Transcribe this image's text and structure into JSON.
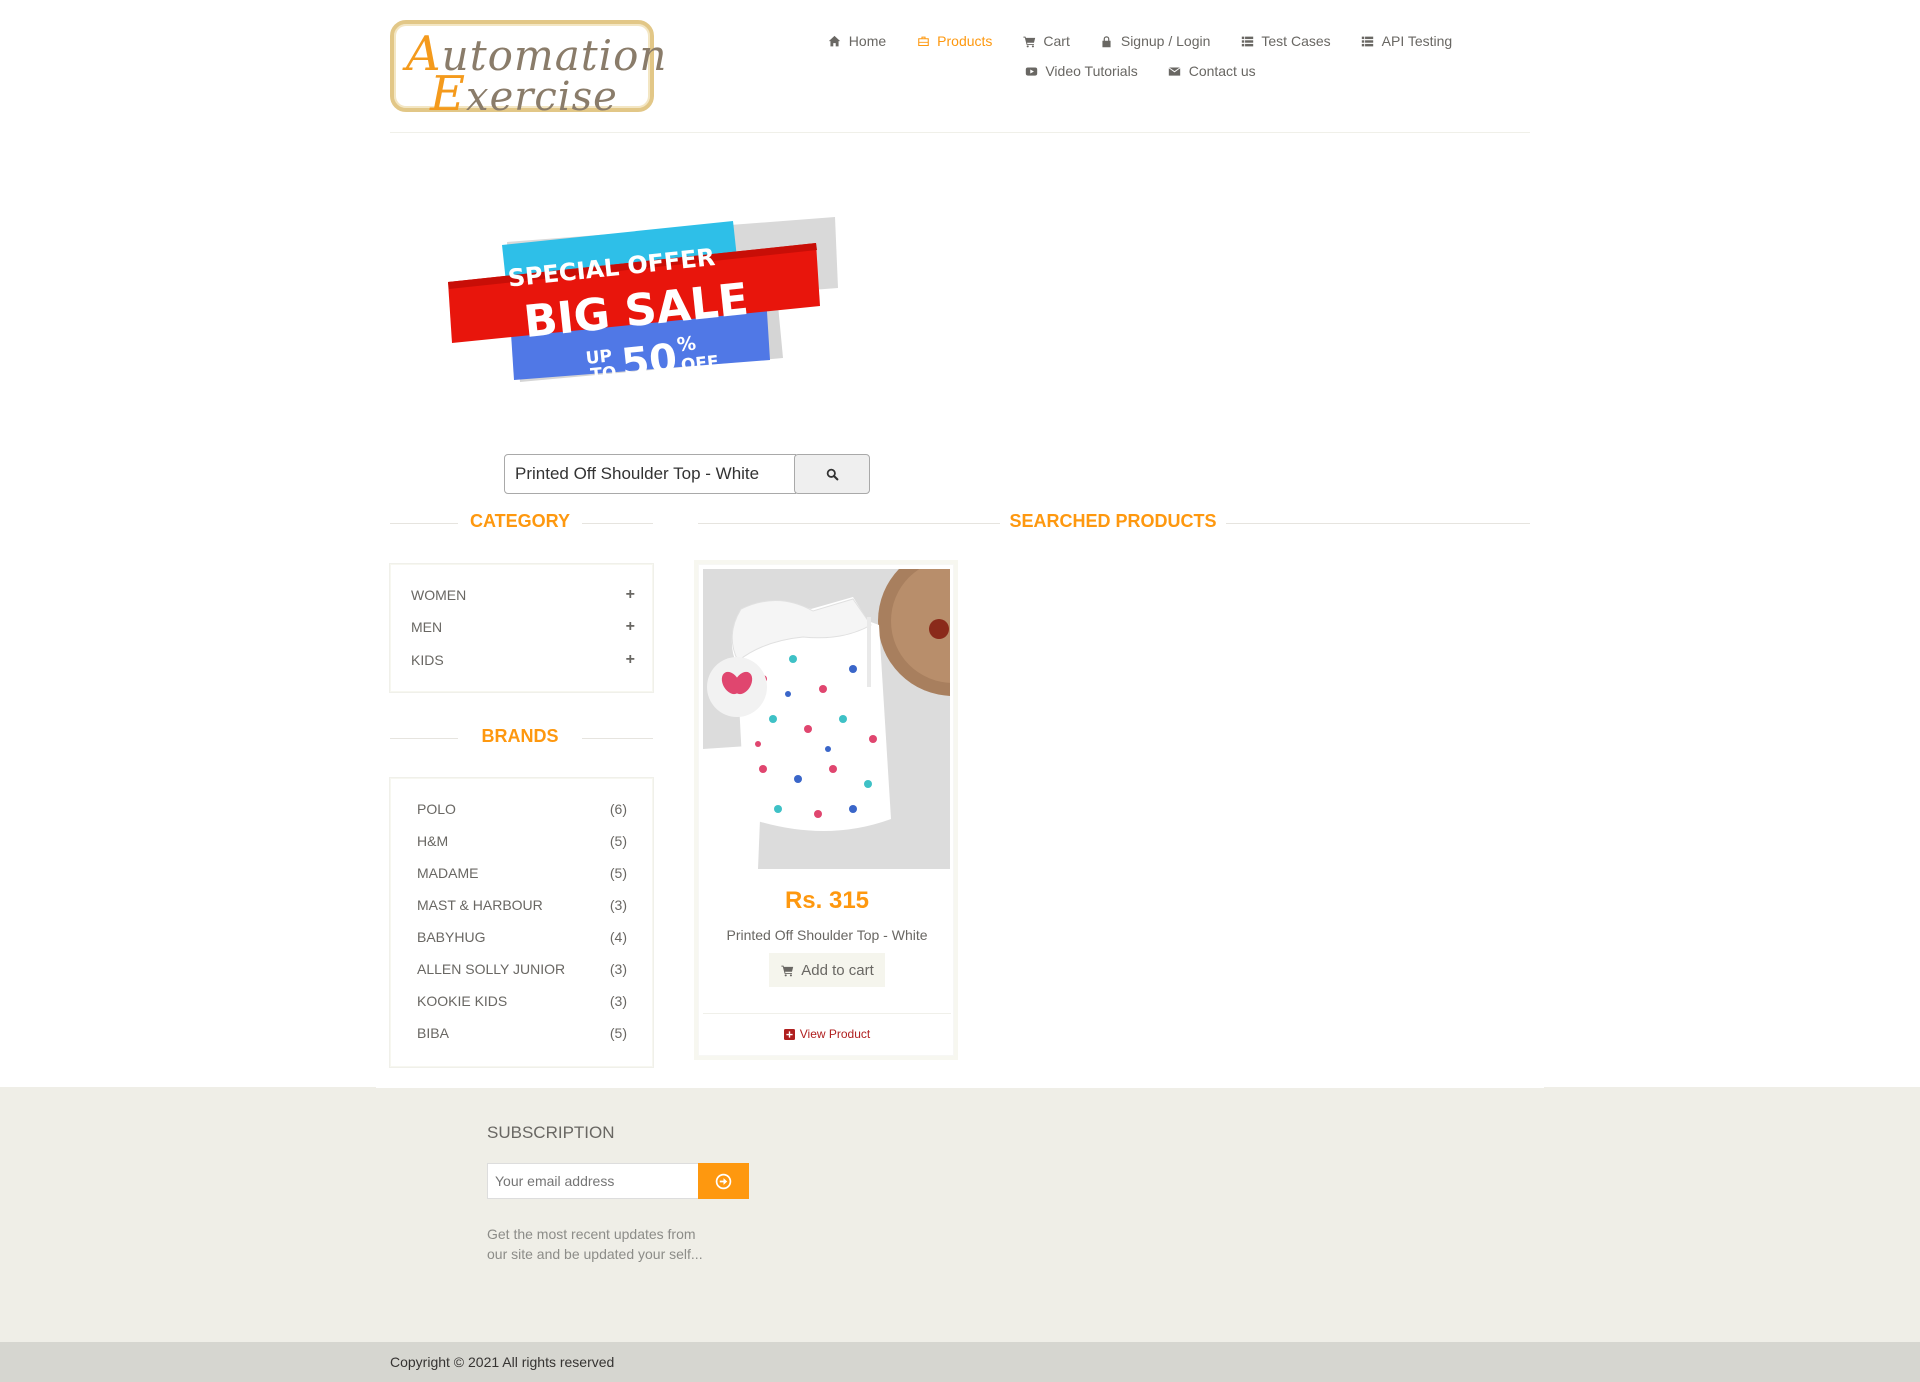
{
  "logo": {
    "line1_cap": "A",
    "line1_rest": "utomation",
    "line2_cap": "E",
    "line2_rest": "xercise"
  },
  "nav": {
    "items": [
      {
        "label": "Home",
        "icon": "home-icon"
      },
      {
        "label": "Products",
        "icon": "briefcase-icon",
        "active": true
      },
      {
        "label": "Cart",
        "icon": "cart-icon"
      },
      {
        "label": "Signup / Login",
        "icon": "lock-icon"
      },
      {
        "label": "Test Cases",
        "icon": "list-icon"
      },
      {
        "label": "API Testing",
        "icon": "list-icon"
      },
      {
        "label": "Video Tutorials",
        "icon": "youtube-icon"
      },
      {
        "label": "Contact us",
        "icon": "envelope-icon"
      }
    ]
  },
  "banner": {
    "line1": "SPECIAL OFFER",
    "line2": "BIG SALE",
    "up": "UP",
    "to": "TO",
    "num": "50",
    "pct": "%",
    "off": "OFF"
  },
  "search": {
    "value": "Printed Off Shoulder Top - White",
    "icon": "search-icon"
  },
  "sidebar": {
    "category_title": "CATEGORY",
    "categories": [
      {
        "label": "WOMEN"
      },
      {
        "label": "MEN"
      },
      {
        "label": "KIDS"
      }
    ],
    "brands_title": "BRANDS",
    "brands": [
      {
        "label": "POLO",
        "count": "(6)"
      },
      {
        "label": "H&M",
        "count": "(5)"
      },
      {
        "label": "MADAME",
        "count": "(5)"
      },
      {
        "label": "MAST & HARBOUR",
        "count": "(3)"
      },
      {
        "label": "BABYHUG",
        "count": "(4)"
      },
      {
        "label": "ALLEN SOLLY JUNIOR",
        "count": "(3)"
      },
      {
        "label": "KOOKIE KIDS",
        "count": "(3)"
      },
      {
        "label": "BIBA",
        "count": "(5)"
      }
    ]
  },
  "main": {
    "title": "SEARCHED PRODUCTS",
    "products": [
      {
        "price": "Rs. 315",
        "name": "Printed Off Shoulder Top - White",
        "add_label": "Add to cart",
        "view_label": "View Product"
      }
    ]
  },
  "footer": {
    "subscription_title": "SUBSCRIPTION",
    "email_placeholder": "Your email address",
    "desc_line1": "Get the most recent updates from",
    "desc_line2": "our site and be updated your self...",
    "copyright": "Copyright © 2021 All rights reserved"
  },
  "colors": {
    "accent": "#fe980f",
    "text": "#696763",
    "footer_bg": "#efeee7",
    "bottom_bar": "#d6d6d0",
    "link_red": "#b01f1f"
  }
}
